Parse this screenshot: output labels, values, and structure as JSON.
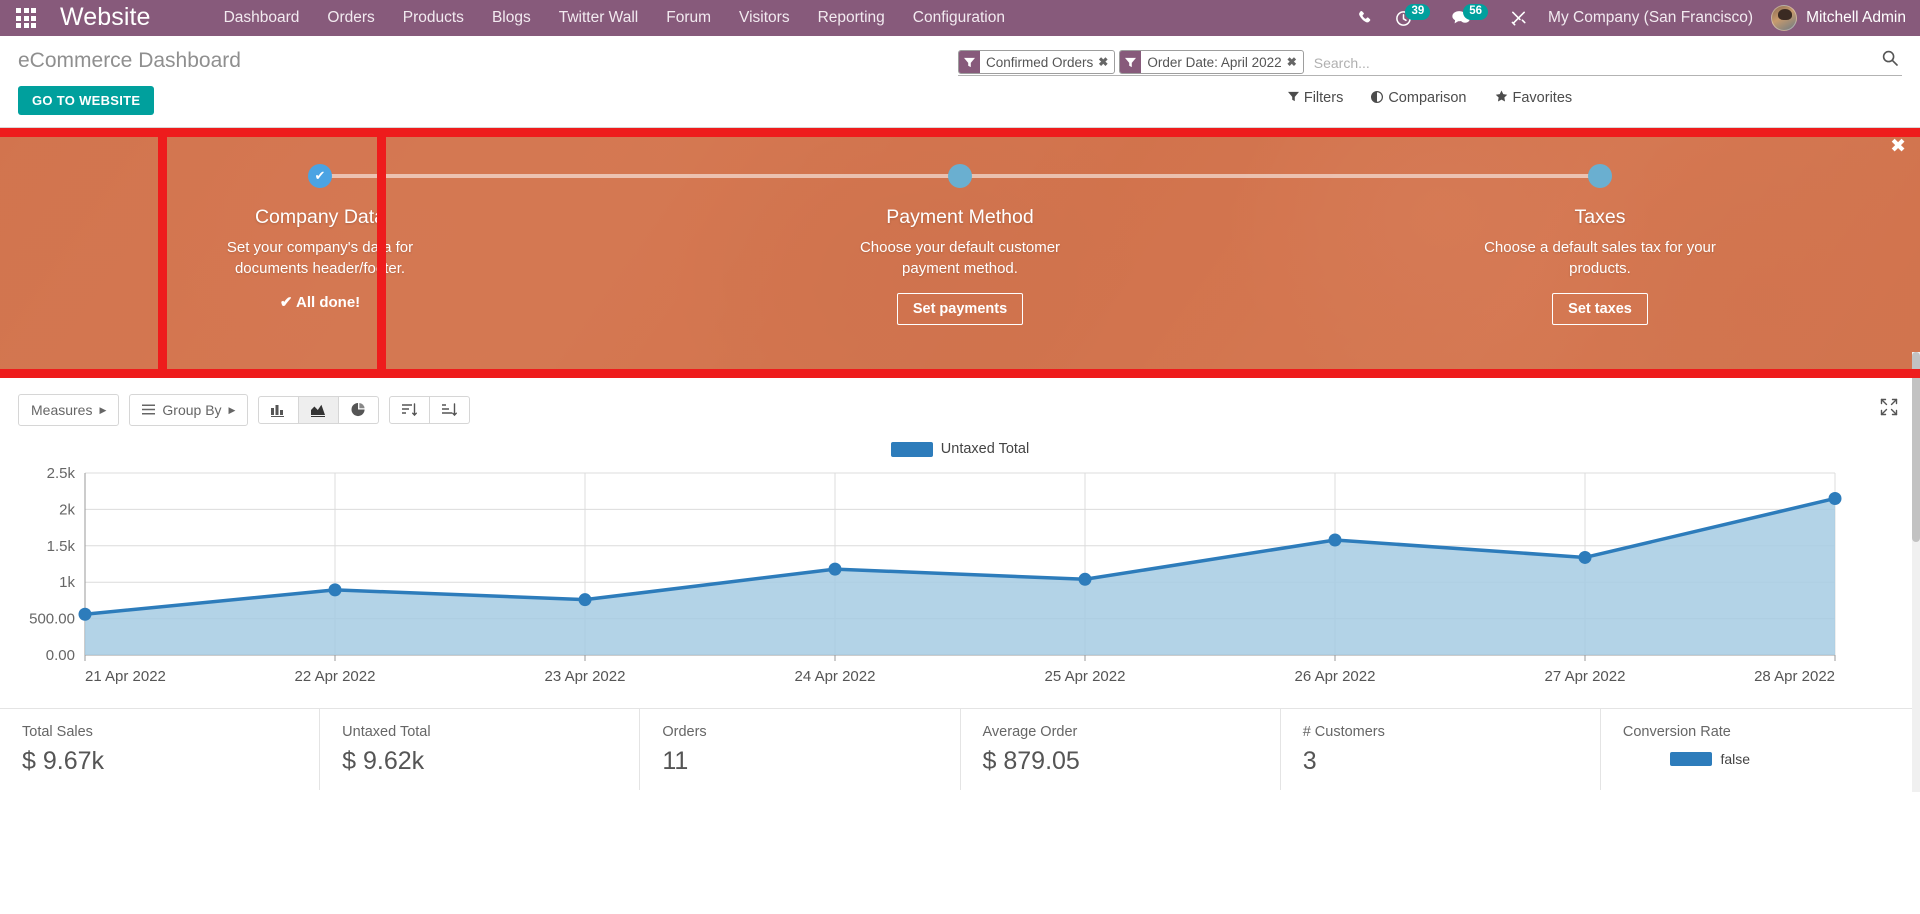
{
  "navbar": {
    "apps_icon": "apps-grid-icon",
    "brand": "Website",
    "menu": [
      {
        "label": "Dashboard"
      },
      {
        "label": "Orders"
      },
      {
        "label": "Products"
      },
      {
        "label": "Blogs"
      },
      {
        "label": "Twitter Wall"
      },
      {
        "label": "Forum"
      },
      {
        "label": "Visitors"
      },
      {
        "label": "Reporting"
      },
      {
        "label": "Configuration"
      }
    ],
    "phone_icon": "phone-icon",
    "activity_icon": "clock-icon",
    "activity_count": "39",
    "messages_icon": "chat-bubble-icon",
    "messages_count": "56",
    "tools_icon": "wrench-screwdriver-icon",
    "company": "My Company (San Francisco)",
    "user": "Mitchell Admin",
    "accent": "#875a7b",
    "badge_color": "#00a09d"
  },
  "control_panel": {
    "title": "eCommerce Dashboard",
    "go_to_website": "GO TO WEBSITE",
    "facets": [
      {
        "label": "Confirmed Orders",
        "icon": "filter-icon",
        "remove": "✖"
      },
      {
        "label": "Order Date: April 2022",
        "icon": "filter-icon",
        "remove": "✖"
      }
    ],
    "search_placeholder": "Search...",
    "search_value": "",
    "search_icon": "magnifier-icon",
    "buttons": [
      {
        "label": "Filters",
        "icon": "filter-icon"
      },
      {
        "label": "Comparison",
        "icon": "adjust-icon"
      },
      {
        "label": "Favorites",
        "icon": "star-icon"
      }
    ]
  },
  "onboarding": {
    "close_icon": "✖",
    "highlighted_step_index": 0,
    "steps": [
      {
        "title": "Company Data",
        "desc": "Set your company's data for documents header/footer.",
        "state": "done",
        "dot_glyph": "✔",
        "status_text": "✔ All done!",
        "button": null
      },
      {
        "title": "Payment Method",
        "desc": "Choose your default customer payment method.",
        "state": "pending",
        "dot_glyph": "",
        "status_text": null,
        "button": "Set payments"
      },
      {
        "title": "Taxes",
        "desc": "Choose a default sales tax for your products.",
        "state": "pending",
        "dot_glyph": "",
        "status_text": null,
        "button": "Set taxes"
      }
    ]
  },
  "chart_toolbar": {
    "measures": "Measures",
    "group_by": "Group By",
    "view_bar_icon": "bar-chart-icon",
    "view_line_icon": "area-chart-icon",
    "view_pie_icon": "pie-chart-icon",
    "sort_desc_icon": "sort-descending-icon",
    "sort_asc_icon": "sort-ascending-icon",
    "expand_icon": "expand-icon",
    "active_view": "line"
  },
  "chart_data": {
    "type": "area",
    "title": "",
    "legend": [
      "Untaxed Total"
    ],
    "legend_position": "top",
    "series": [
      {
        "name": "Untaxed Total",
        "values": [
          560,
          895,
          760,
          1180,
          1040,
          1580,
          1340,
          2150
        ],
        "color": "#2d7cbb",
        "fill": "#a6cbe3"
      }
    ],
    "categories": [
      "21 Apr 2022",
      "22 Apr 2022",
      "23 Apr 2022",
      "24 Apr 2022",
      "25 Apr 2022",
      "26 Apr 2022",
      "27 Apr 2022",
      "28 Apr 2022"
    ],
    "ytick_labels": [
      "2.5k",
      "2k",
      "1.5k",
      "1k",
      "500.00",
      "0.00"
    ],
    "ytick_values": [
      2500,
      2000,
      1500,
      1000,
      500,
      0
    ],
    "ylim": [
      0,
      2500
    ],
    "xlabel": "",
    "ylabel": "",
    "grid": true
  },
  "kpis": [
    {
      "label": "Total Sales",
      "value": "$ 9.67k"
    },
    {
      "label": "Untaxed Total",
      "value": "$ 9.62k"
    },
    {
      "label": "Orders",
      "value": "11"
    },
    {
      "label": "Average Order",
      "value": "$ 879.05"
    },
    {
      "label": "# Customers",
      "value": "3"
    },
    {
      "label": "Conversion Rate",
      "value": "",
      "legend_text": "false"
    }
  ]
}
